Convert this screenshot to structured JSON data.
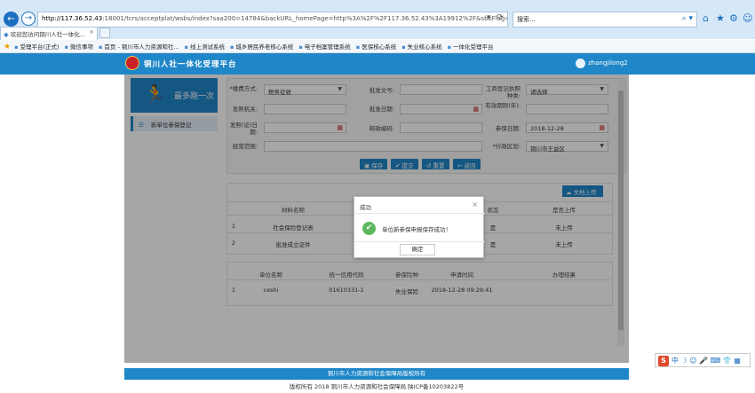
{
  "browser": {
    "url_host": "http://117.36.52.43",
    "url_rest": ":18001/tcrs/acceptplat/wsbs/index?saa200=14784&backURL_homePage=http%3A%2F%2F117.36.52.43%3A19912%2F&sbkFlag=1&u",
    "search_placeholder": "搜索...",
    "tab_title": "欢迎您访问铜川人社一体化...",
    "favorites": [
      "受理平台(正式)",
      "微信事项",
      "首页 - 铜川市人力资源和社...",
      "线上测试系统",
      "城乡居民养老核心系统",
      "电子档案管理系统",
      "医保核心系统",
      "失业核心系统",
      "一体化受理平台"
    ]
  },
  "app": {
    "title": "铜川人社一体化受理平台",
    "user": "zhangjilong2"
  },
  "sidebar": {
    "banner_text": "最多跑一次",
    "items": [
      {
        "label": "新单位参保登记"
      }
    ]
  },
  "form": {
    "fields": {
      "collect_mode": {
        "label": "*缴费方式:",
        "value": "税务征收"
      },
      "approval_doc": {
        "label": "批准文号:",
        "value": ""
      },
      "industrial_injury_level": {
        "label": "工商登记执照种类:",
        "value": "请选择"
      },
      "issuing_org": {
        "label": "发照机关:",
        "value": ""
      },
      "approval_date": {
        "label": "批准日期:",
        "value": ""
      },
      "validity_period": {
        "label": "有效期限(年):",
        "value": ""
      },
      "issue_date": {
        "label": "发照(证)日期:",
        "value": ""
      },
      "postal_code": {
        "label": "邮政编码:",
        "value": ""
      },
      "insured_date": {
        "label": "参保日期:",
        "value": "2018-12-28"
      },
      "business_scope": {
        "label": "经营范围:",
        "value": ""
      },
      "admin_region": {
        "label": "*行政区划:",
        "value": "铜川市王益区"
      }
    },
    "buttons": {
      "save": "保存",
      "submit": "提交",
      "reset": "重置",
      "back": "返回"
    }
  },
  "materials": {
    "upload_button": "文档上传",
    "headers": [
      "材料名称",
      "状态",
      "是否上传"
    ],
    "rows": [
      {
        "index": "1",
        "name": "社会保险登记表",
        "status": "是",
        "uploaded": "未上传"
      },
      {
        "index": "2",
        "name": "批准成立证件",
        "status": "是",
        "uploaded": "未上传"
      }
    ]
  },
  "applications": {
    "headers": [
      "单位名称",
      "统一信用代码",
      "参保险种",
      "申请时间",
      "办理结果"
    ],
    "rows": [
      {
        "index": "1",
        "unit": "ceshi",
        "code": "01610331-1",
        "insurance": "失业保险",
        "time": "2018-12-28 09:29:41",
        "result": ""
      }
    ]
  },
  "modal": {
    "title": "成功",
    "message": "单位新参保申报保存成功！",
    "ok_label": "确定"
  },
  "footer": {
    "line1": "铜川市人力资源和社会保障局版权所有",
    "line2": "版权所有 2018 铜川市人力资源和社会保障局 陕ICP备10203822号"
  },
  "ime": {
    "label": "中"
  },
  "colors": {
    "brand": "#1f86c8",
    "success": "#5cb85c"
  }
}
